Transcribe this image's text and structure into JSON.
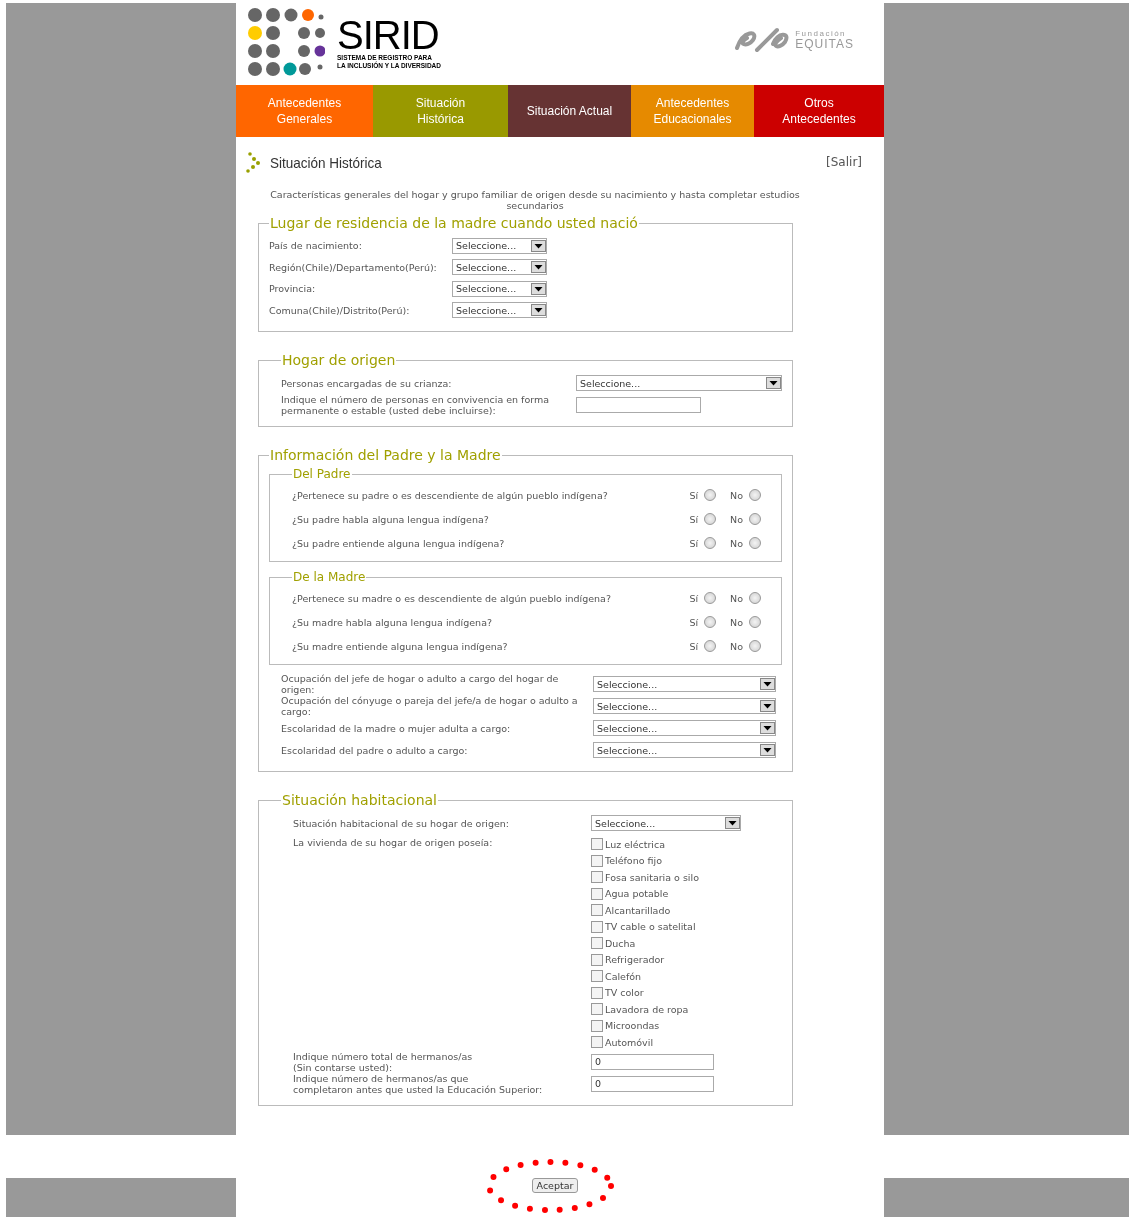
{
  "header": {
    "logo_title": "SIRID",
    "logo_subtitle": [
      "SISTEMA DE REGISTRO PARA",
      "LA INCLUSIÓN Y LA DIVERSIDAD"
    ],
    "partner_small": "Fundación",
    "partner_name": "EQUITAS"
  },
  "tabs": [
    {
      "label": "Antecedentes Generales",
      "color": "#ff6600"
    },
    {
      "label": "Situación Histórica",
      "color": "#999900"
    },
    {
      "label": "Situación Actual",
      "color": "#663333"
    },
    {
      "label": "Antecedentes Educacionales",
      "color": "#e68a00"
    },
    {
      "label": "Otros Antecedentes",
      "color": "#cc0000"
    }
  ],
  "page_title": "Situación Histórica",
  "exit_link": "[Salir]",
  "intro": "Características generales del hogar y grupo familiar de origen desde su nacimiento y hasta completar estudios secundarios",
  "sections": [
    {
      "legend": "Lugar de residencia de la madre cuando usted nació",
      "fields": [
        {
          "kind": "select",
          "label": "País de nacimiento:",
          "value": "Seleccione..."
        },
        {
          "kind": "select",
          "label": "Región(Chile)/Departamento(Perú):",
          "value": "Seleccione..."
        },
        {
          "kind": "select",
          "label": "Provincia:",
          "value": "Seleccione..."
        },
        {
          "kind": "select",
          "label": "Comuna(Chile)/Distrito(Perú):",
          "value": "Seleccione..."
        }
      ]
    },
    {
      "legend": "Hogar de origen",
      "fields": [
        {
          "kind": "select",
          "label": "Personas encargadas de su crianza:",
          "value": "Seleccione..."
        },
        {
          "kind": "input",
          "label": "Indique el número de personas en convivencia en forma permanente o estable (usted debe incluirse):"
        }
      ]
    },
    {
      "legend": "Información del Padre y la Madre",
      "fields": [
        {
          "kind": "group",
          "legend": "Del Padre",
          "questions": [
            {
              "text": "¿Pertenece su padre o es descendiente de algún pueblo indígena?",
              "options": [
                {
                  "label": "Sí",
                  "selected": false
                },
                {
                  "label": "No",
                  "selected": false
                }
              ]
            },
            {
              "text": "¿Su padre habla alguna lengua indígena?",
              "options": [
                {
                  "label": "Sí",
                  "selected": false
                },
                {
                  "label": "No",
                  "selected": false
                }
              ]
            },
            {
              "text": "¿Su padre entiende alguna lengua indígena?",
              "options": [
                {
                  "label": "Sí",
                  "selected": false
                },
                {
                  "label": "No",
                  "selected": false
                }
              ]
            }
          ]
        },
        {
          "kind": "group",
          "legend": "De la Madre",
          "questions": [
            {
              "text": "¿Pertenece su madre o es descendiente de algún pueblo indígena?",
              "options": [
                {
                  "label": "Sí",
                  "selected": false
                },
                {
                  "label": "No",
                  "selected": false
                }
              ]
            },
            {
              "text": "¿Su madre habla alguna lengua indígena?",
              "options": [
                {
                  "label": "Sí",
                  "selected": false
                },
                {
                  "label": "No",
                  "selected": false
                }
              ]
            },
            {
              "text": "¿Su madre entiende alguna lengua indígena?",
              "options": [
                {
                  "label": "Sí",
                  "selected": false
                },
                {
                  "label": "No",
                  "selected": false
                }
              ]
            }
          ]
        },
        {
          "kind": "select",
          "label": "Ocupación del jefe de hogar o adulto a cargo del hogar de origen:",
          "value": "Seleccione..."
        },
        {
          "kind": "select",
          "label": "Ocupación del cónyuge o pareja del jefe/a de hogar o adulto a cargo:",
          "value": "Seleccione..."
        },
        {
          "kind": "select",
          "label": "Escolaridad de la madre o mujer adulta a cargo:",
          "value": "Seleccione..."
        },
        {
          "kind": "select",
          "label": "Escolaridad del padre o adulto a cargo:",
          "value": "Seleccione..."
        }
      ]
    },
    {
      "legend": "Situación habitacional",
      "fields": [
        {
          "kind": "select",
          "label": "Situación habitacional de su hogar de origen:",
          "value": "Seleccione..."
        },
        {
          "kind": "checklist",
          "label": "La vivienda de su hogar de origen poseía:",
          "items": [
            {
              "label": "Luz eléctrica",
              "checked": false
            },
            {
              "label": "Teléfono fijo",
              "checked": false
            },
            {
              "label": "Fosa sanitaria o silo",
              "checked": false
            },
            {
              "label": "Agua potable",
              "checked": false
            },
            {
              "label": "Alcantarillado",
              "checked": false
            },
            {
              "label": "TV cable o satelital",
              "checked": false
            },
            {
              "label": "Ducha",
              "checked": false
            },
            {
              "label": "Refrigerador",
              "checked": false
            },
            {
              "label": "Calefón",
              "checked": false
            },
            {
              "label": "TV color",
              "checked": false
            },
            {
              "label": "Lavadora de ropa",
              "checked": false
            },
            {
              "label": "Microondas",
              "checked": false
            },
            {
              "label": "Automóvil",
              "checked": false
            }
          ]
        },
        {
          "kind": "input",
          "label": "Indique número total de hermanos/as\n(Sin contarse usted):",
          "value": "0"
        },
        {
          "kind": "input",
          "label": "Indique número de hermanos/as que\ncompletaron antes que usted la Educación Superior:",
          "value": "0"
        }
      ]
    }
  ],
  "submit": "Aceptar"
}
